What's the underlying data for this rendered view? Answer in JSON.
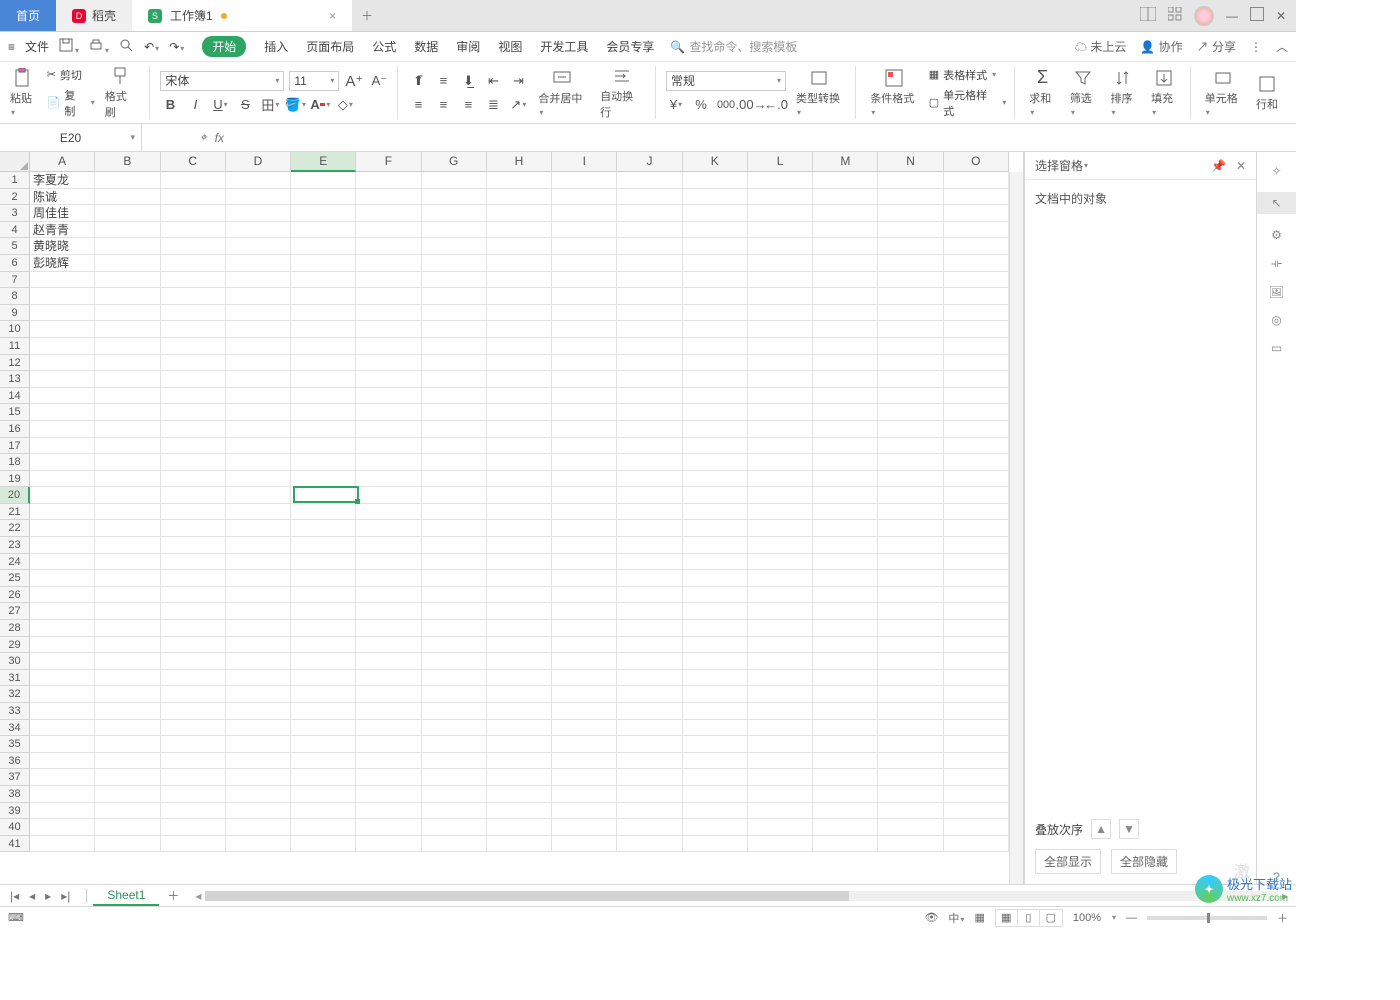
{
  "titlebar": {
    "home": "首页",
    "daoke": "稻壳",
    "workbook": "工作簿1"
  },
  "qat": {
    "file": "文件"
  },
  "menus": {
    "start": "开始",
    "insert": "插入",
    "layout": "页面布局",
    "formula": "公式",
    "data": "数据",
    "review": "审阅",
    "view": "视图",
    "devtools": "开发工具",
    "member": "会员专享"
  },
  "search_placeholder": "查找命令、搜索模板",
  "menuright": {
    "cloud": "未上云",
    "collab": "协作",
    "share": "分享"
  },
  "ribbon": {
    "paste": "粘贴",
    "cut": "剪切",
    "copy": "复制",
    "brush": "格式刷",
    "font": "宋体",
    "size": "11",
    "merge": "合并居中",
    "wrap": "自动换行",
    "numfmt": "常规",
    "typeconv": "类型转换",
    "condfmt": "条件格式",
    "tablestyle": "表格样式",
    "cellstyle": "单元格样式",
    "sum": "求和",
    "filter": "筛选",
    "sort": "排序",
    "fill": "填充",
    "cell": "单元格",
    "row": "行和"
  },
  "namebox": "E20",
  "columns": [
    "A",
    "B",
    "C",
    "D",
    "E",
    "F",
    "G",
    "H",
    "I",
    "J",
    "K",
    "L",
    "M",
    "N",
    "O"
  ],
  "selcol": "E",
  "rows": 41,
  "selrow": 20,
  "cells": {
    "A1": "李夏龙",
    "A2": "陈诚",
    "A3": "周佳佳",
    "A4": "赵青青",
    "A5": "黄晓晓",
    "A6": "彭晓辉"
  },
  "selpane": {
    "title": "选择窗格",
    "label": "文档中的对象",
    "stack": "叠放次序",
    "showall": "全部显示",
    "hideall": "全部隐藏"
  },
  "sheet": "Sheet1",
  "zoom": "100%",
  "watermark": {
    "a": "极光下载站",
    "b": "www.xz7.com"
  },
  "act": "激"
}
